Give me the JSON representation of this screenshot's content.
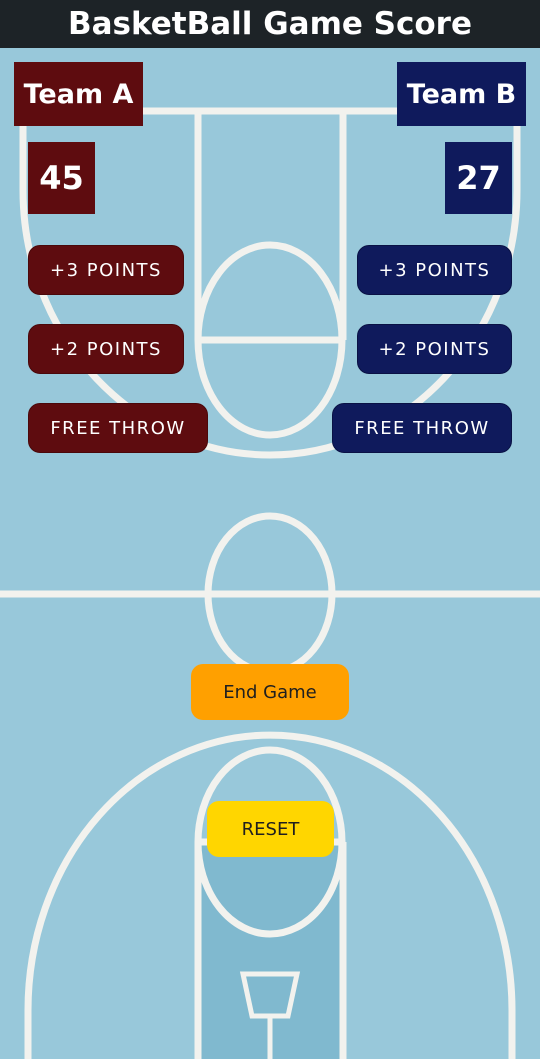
{
  "app": {
    "title": "BasketBall Game Score"
  },
  "team_a": {
    "name": "Team A",
    "score": "45",
    "buttons": {
      "three": "+3 POINTS",
      "two": "+2 POINTS",
      "free_throw": "FREE THROW"
    }
  },
  "team_b": {
    "name": "Team B",
    "score": "27",
    "buttons": {
      "three": "+3 POINTS",
      "two": "+2 POINTS",
      "free_throw": "FREE THROW"
    }
  },
  "controls": {
    "end_game": "End Game",
    "reset": "RESET"
  },
  "colors": {
    "court": "#98c8da",
    "paint": "#80b9cf",
    "lines": "#f2f2ee",
    "team_a": "#5e0c0f",
    "team_b": "#0f1a5c",
    "end_game": "#ffa000",
    "reset": "#ffd600",
    "title_bar": "#1d2327"
  }
}
